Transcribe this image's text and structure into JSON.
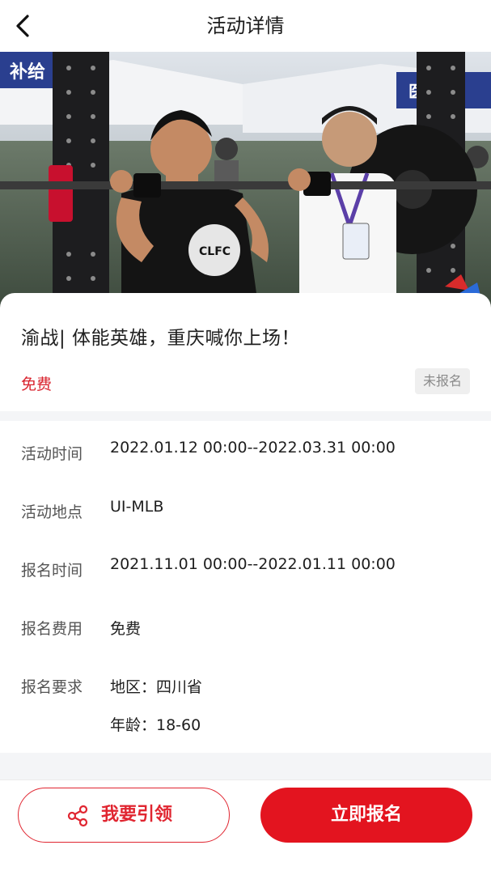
{
  "header": {
    "title": "活动详情",
    "back_icon": "chevron-left-icon"
  },
  "event": {
    "title": "渝战| 体能英雄，重庆喊你上场！",
    "price": "免费",
    "status": "未报名",
    "hero_banner_text_left": "补给",
    "hero_banner_text_right": "医疗救",
    "hero_shirt_text": "CLFC"
  },
  "details": {
    "rows": [
      {
        "label": "活动时间",
        "value": "2022.01.12 00:00--2022.03.31 00:00"
      },
      {
        "label": "活动地点",
        "value": "UI-MLB"
      },
      {
        "label": "报名时间",
        "value": "2021.11.01 00:00--2022.01.11 00:00"
      },
      {
        "label": "报名费用",
        "value": "免费"
      },
      {
        "label": "报名要求",
        "value": "地区：四川省"
      }
    ],
    "extra_requirement": "年龄：18-60"
  },
  "actions": {
    "claim_label": "我要引领",
    "claim_icon": "share-icon",
    "signup_label": "立即报名"
  },
  "colors": {
    "accent": "#e3141f",
    "price": "#d9232e",
    "page_bg": "#f4f5f7"
  }
}
